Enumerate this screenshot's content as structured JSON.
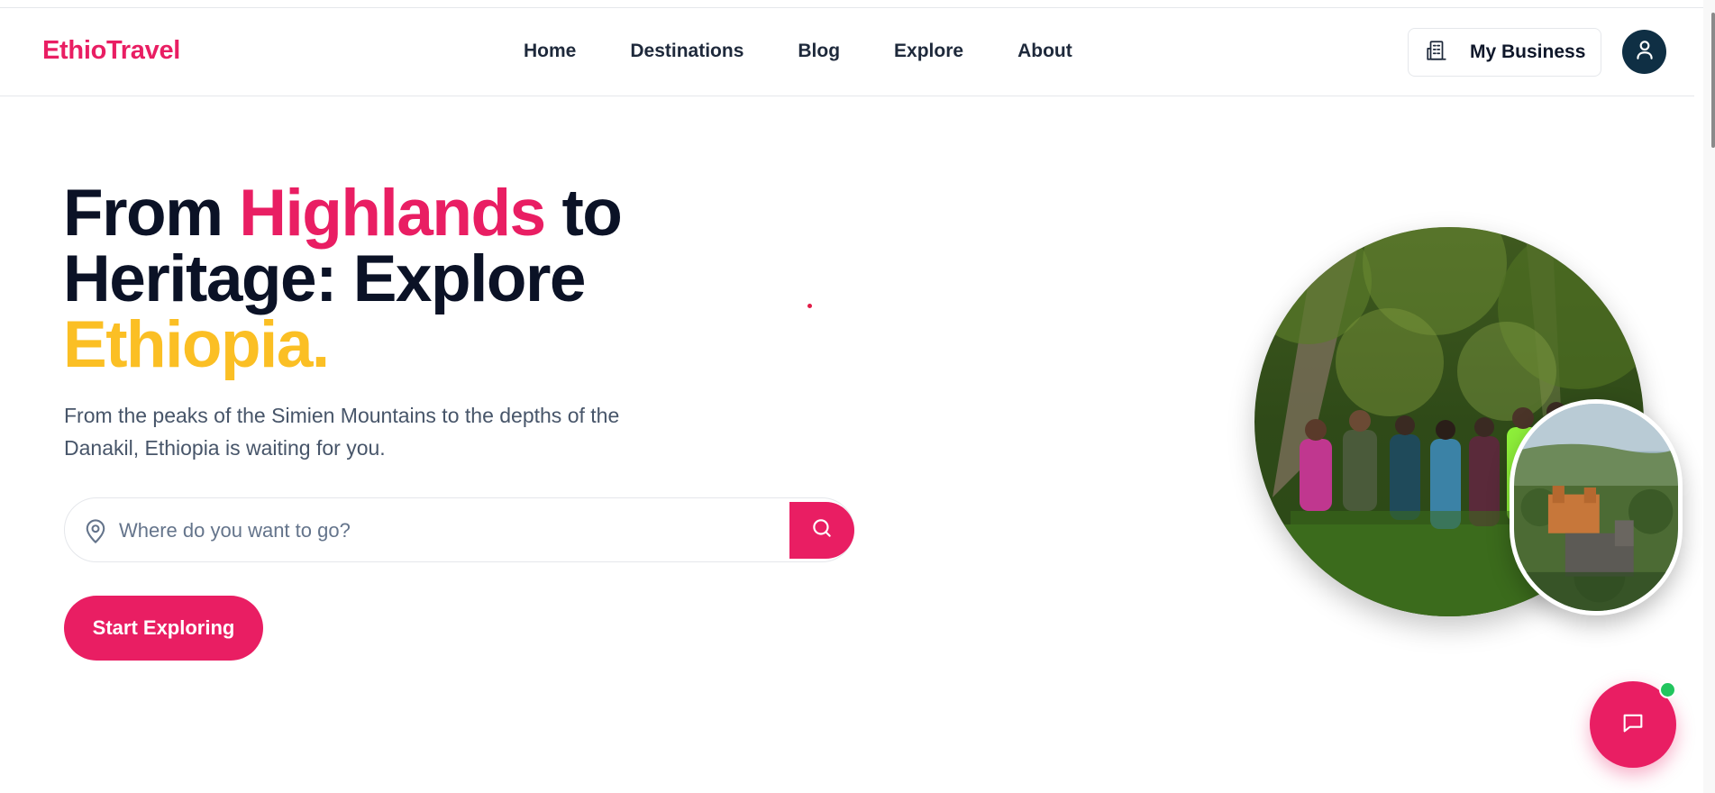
{
  "brand": {
    "name": "EthioTravel",
    "color": "#e91e63"
  },
  "nav": {
    "items": [
      {
        "label": "Home"
      },
      {
        "label": "Destinations"
      },
      {
        "label": "Blog"
      },
      {
        "label": "Explore"
      },
      {
        "label": "About"
      }
    ]
  },
  "header": {
    "business_label": "My Business",
    "business_icon": "building-icon",
    "avatar_icon": "user-icon"
  },
  "hero": {
    "title_part1": "From ",
    "title_highlight1": "Highlands",
    "title_part2": " to Heritage: Explore ",
    "title_highlight2": "Ethiopia.",
    "subtitle": "From the peaks of the Simien Mountains to the depths of the Danakil, Ethiopia is waiting for you.",
    "accent_pink": "#e91e63",
    "accent_yellow": "#fbbf24"
  },
  "search": {
    "placeholder": "Where do you want to go?",
    "value": "",
    "pin_icon": "map-pin-icon",
    "button_icon": "search-icon"
  },
  "cta": {
    "label": "Start Exploring"
  },
  "images": {
    "main": "group-of-hikers-in-forest",
    "secondary": "castle-in-town"
  },
  "chat": {
    "icon": "chat-icon",
    "online_status_color": "#22c55e"
  }
}
